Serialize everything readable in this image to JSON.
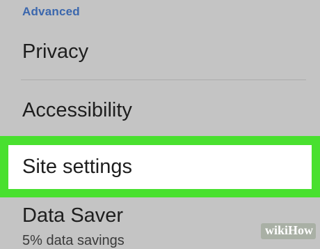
{
  "settings": {
    "section_header": "Advanced",
    "items": [
      {
        "label": "Privacy"
      },
      {
        "label": "Accessibility"
      },
      {
        "label": "Site settings",
        "highlighted": true
      },
      {
        "label": "Data Saver",
        "sublabel": "5% data savings"
      }
    ]
  },
  "watermark": {
    "text_wiki": "wiki",
    "text_how": "How"
  },
  "colors": {
    "background": "#c4c4c4",
    "section_header": "#3b67ad",
    "highlight": "#49e02f",
    "highlighted_item_bg": "#ffffff"
  }
}
